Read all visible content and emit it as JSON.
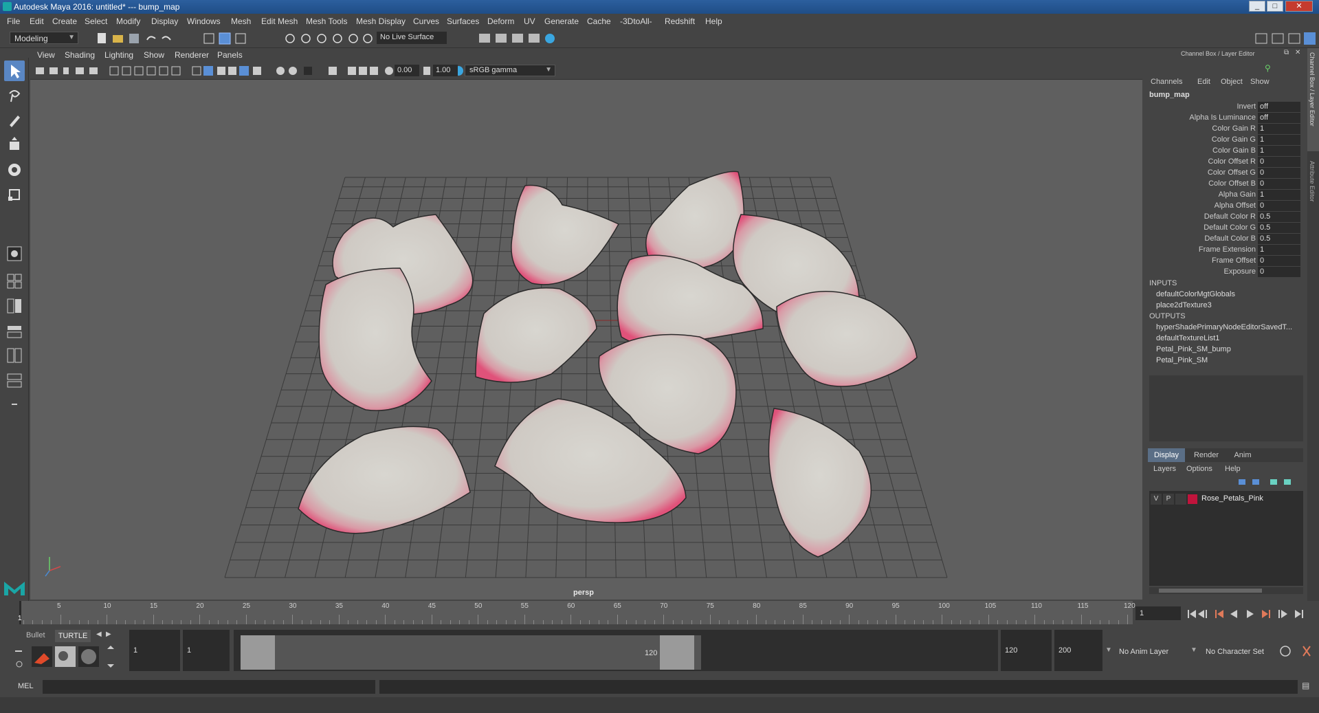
{
  "window": {
    "title": "Autodesk Maya 2016: untitled*   ---   bump_map",
    "minimize": "_",
    "maximize": "□",
    "close": "✕"
  },
  "menus": [
    "File",
    "Edit",
    "Create",
    "Select",
    "Modify",
    "Display",
    "Windows",
    "Mesh",
    "Edit Mesh",
    "Mesh Tools",
    "Mesh Display",
    "Curves",
    "Surfaces",
    "Deform",
    "UV",
    "Generate",
    "Cache",
    "-3DtoAll-",
    "Redshift",
    "Help"
  ],
  "statusline": {
    "mode": "Modeling",
    "live_surface": "No Live Surface"
  },
  "viewport": {
    "menus": [
      "View",
      "Shading",
      "Lighting",
      "Show",
      "Renderer",
      "Panels"
    ],
    "exposure": "0.00",
    "gamma": "1.00",
    "color_space": "sRGB gamma",
    "camera_label": "persp"
  },
  "channel_box": {
    "header": "Channel Box / Layer Editor",
    "tabs": [
      "Channels",
      "Edit",
      "Object",
      "Show"
    ],
    "node_name": "bump_map",
    "attributes": [
      {
        "label": "Invert",
        "value": "off"
      },
      {
        "label": "Alpha Is Luminance",
        "value": "off"
      },
      {
        "label": "Color Gain R",
        "value": "1"
      },
      {
        "label": "Color Gain G",
        "value": "1"
      },
      {
        "label": "Color Gain B",
        "value": "1"
      },
      {
        "label": "Color Offset R",
        "value": "0"
      },
      {
        "label": "Color Offset G",
        "value": "0"
      },
      {
        "label": "Color Offset B",
        "value": "0"
      },
      {
        "label": "Alpha Gain",
        "value": "1"
      },
      {
        "label": "Alpha Offset",
        "value": "0"
      },
      {
        "label": "Default Color R",
        "value": "0.5"
      },
      {
        "label": "Default Color G",
        "value": "0.5"
      },
      {
        "label": "Default Color B",
        "value": "0.5"
      },
      {
        "label": "Frame Extension",
        "value": "1"
      },
      {
        "label": "Frame Offset",
        "value": "0"
      },
      {
        "label": "Exposure",
        "value": "0"
      }
    ],
    "inputs_label": "INPUTS",
    "inputs": [
      "defaultColorMgtGlobals",
      "place2dTexture3"
    ],
    "outputs_label": "OUTPUTS",
    "outputs": [
      "hyperShadePrimaryNodeEditorSavedT...",
      "defaultTextureList1",
      "Petal_Pink_SM_bump",
      "Petal_Pink_SM"
    ]
  },
  "layer_editor": {
    "tabs": [
      "Display",
      "Render",
      "Anim"
    ],
    "menus": [
      "Layers",
      "Options",
      "Help"
    ],
    "layer": {
      "v": "V",
      "p": "P",
      "name": "Rose_Petals_Pink",
      "color": "#c0143c"
    }
  },
  "side_tabs": [
    "Channel Box / Layer Editor",
    "Attribute Editor"
  ],
  "timeline": {
    "ticks": [
      "5",
      "10",
      "15",
      "20",
      "25",
      "30",
      "35",
      "40",
      "45",
      "50",
      "55",
      "60",
      "65",
      "70",
      "75",
      "80",
      "85",
      "90",
      "95",
      "100",
      "105",
      "110",
      "115",
      "120"
    ],
    "start_label": "1",
    "current_frame": "1"
  },
  "range": {
    "shelf_tabs": [
      "Bullet",
      "TURTLE"
    ],
    "start_time": "1",
    "playback_start": "1",
    "range_start_label": "1",
    "range_end_label": "120",
    "playback_end": "120",
    "end_time": "200",
    "anim_layer": "No Anim Layer",
    "character_set": "No Character Set"
  },
  "command": {
    "label": "MEL"
  }
}
